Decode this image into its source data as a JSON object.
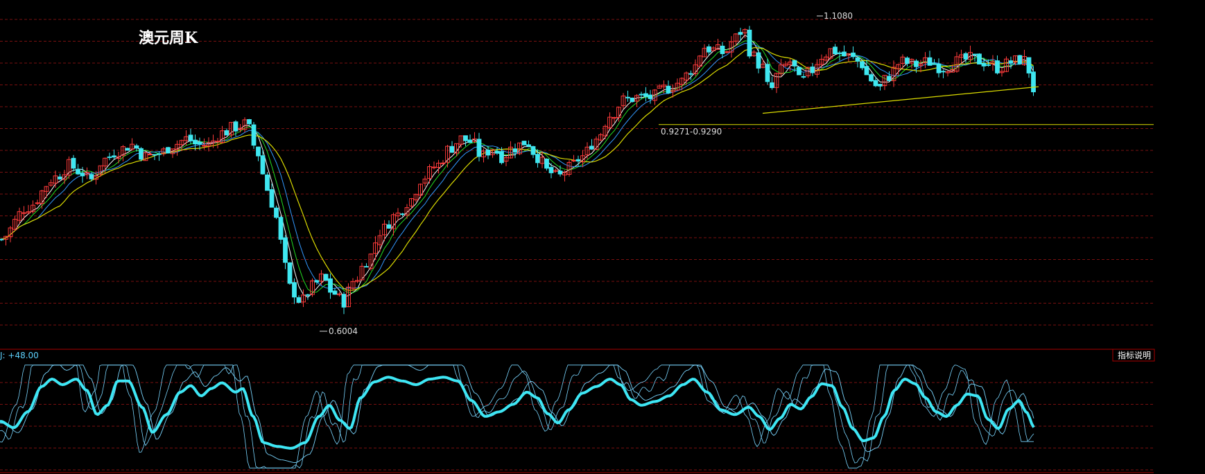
{
  "colors": {
    "background": "#000000",
    "grid": "#7a1010",
    "up_candle": "#ff3b3b",
    "down_candle": "#3fe7f0",
    "ma_short": "#ffffff",
    "ma_mid": "#ffff33",
    "ma_green": "#22dd22",
    "ma_blue": "#3399ff",
    "ma_long": "#dddd00",
    "trendline": "#dddd00",
    "kdj_bold": "#3ee6f4",
    "kdj_thin": "#7ad6ff",
    "separator": "#aa0000"
  },
  "header": {
    "title": "澳元周K"
  },
  "main_chart": {
    "annotations": {
      "high": "1.1080",
      "low": "0.6004",
      "level": "0.9271-0.9290"
    }
  },
  "indicator_panel": {
    "label": "J: +48.00",
    "legend_button": "指标说明"
  },
  "chart_data": [
    {
      "type": "candlestick",
      "title": "澳元周K",
      "ylim": [
        0.56,
        1.13
      ],
      "grid": true,
      "anchors": [
        [
          0,
          0.735
        ],
        [
          40,
          0.79
        ],
        [
          80,
          0.84
        ],
        [
          100,
          0.86
        ],
        [
          115,
          0.85
        ],
        [
          130,
          0.835
        ],
        [
          150,
          0.87
        ],
        [
          170,
          0.885
        ],
        [
          190,
          0.895
        ],
        [
          210,
          0.875
        ],
        [
          230,
          0.88
        ],
        [
          250,
          0.895
        ],
        [
          270,
          0.905
        ],
        [
          285,
          0.895
        ],
        [
          300,
          0.895
        ],
        [
          320,
          0.915
        ],
        [
          340,
          0.925
        ],
        [
          355,
          0.93
        ],
        [
          372,
          0.88
        ],
        [
          385,
          0.82
        ],
        [
          400,
          0.77
        ],
        [
          410,
          0.69
        ],
        [
          420,
          0.65
        ],
        [
          435,
          0.63
        ],
        [
          450,
          0.655
        ],
        [
          465,
          0.67
        ],
        [
          480,
          0.645
        ],
        [
          495,
          0.63
        ],
        [
          510,
          0.665
        ],
        [
          530,
          0.7
        ],
        [
          550,
          0.75
        ],
        [
          570,
          0.775
        ],
        [
          590,
          0.8
        ],
        [
          610,
          0.84
        ],
        [
          630,
          0.86
        ],
        [
          650,
          0.89
        ],
        [
          665,
          0.905
        ],
        [
          680,
          0.9
        ],
        [
          695,
          0.875
        ],
        [
          710,
          0.89
        ],
        [
          725,
          0.875
        ],
        [
          740,
          0.89
        ],
        [
          760,
          0.9
        ],
        [
          775,
          0.875
        ],
        [
          790,
          0.85
        ],
        [
          805,
          0.84
        ],
        [
          820,
          0.855
        ],
        [
          840,
          0.875
        ],
        [
          860,
          0.905
        ],
        [
          880,
          0.945
        ],
        [
          900,
          0.97
        ],
        [
          920,
          0.975
        ],
        [
          940,
          0.975
        ],
        [
          960,
          0.99
        ],
        [
          980,
          1.0
        ],
        [
          1000,
          1.025
        ],
        [
          1015,
          1.06
        ],
        [
          1030,
          1.055
        ],
        [
          1045,
          1.05
        ],
        [
          1060,
          1.075
        ],
        [
          1072,
          1.09
        ],
        [
          1085,
          1.045
        ],
        [
          1100,
          1.025
        ],
        [
          1110,
          0.985
        ],
        [
          1125,
          1.02
        ],
        [
          1140,
          1.035
        ],
        [
          1155,
          1.0
        ],
        [
          1170,
          1.02
        ],
        [
          1185,
          1.045
        ],
        [
          1200,
          1.055
        ],
        [
          1220,
          1.045
        ],
        [
          1240,
          1.035
        ],
        [
          1255,
          1.005
        ],
        [
          1268,
          0.99
        ],
        [
          1280,
          1.01
        ],
        [
          1300,
          1.035
        ],
        [
          1320,
          1.03
        ],
        [
          1340,
          1.035
        ],
        [
          1360,
          1.025
        ],
        [
          1380,
          1.035
        ],
        [
          1400,
          1.04
        ],
        [
          1420,
          1.035
        ],
        [
          1440,
          1.025
        ],
        [
          1460,
          1.035
        ],
        [
          1475,
          1.04
        ],
        [
          1485,
          1.02
        ],
        [
          1492,
          0.985
        ]
      ],
      "high_label": "1.1080",
      "low_label": "0.6004",
      "level_label": "0.9271-0.9290",
      "horizontal_level": 0.929,
      "trendline": {
        "from": [
          1100,
          0.948
        ],
        "to": [
          1498,
          0.993
        ]
      }
    },
    {
      "type": "line",
      "indicator": "KDJ",
      "ylim": [
        -10,
        110
      ],
      "label": "J: +48.00",
      "series_J_anchors": [
        [
          0,
          45
        ],
        [
          20,
          38
        ],
        [
          40,
          55
        ],
        [
          60,
          82
        ],
        [
          75,
          90
        ],
        [
          90,
          84
        ],
        [
          110,
          90
        ],
        [
          125,
          78
        ],
        [
          140,
          52
        ],
        [
          155,
          62
        ],
        [
          170,
          88
        ],
        [
          185,
          88
        ],
        [
          205,
          60
        ],
        [
          220,
          33
        ],
        [
          240,
          52
        ],
        [
          260,
          76
        ],
        [
          275,
          83
        ],
        [
          290,
          72
        ],
        [
          305,
          80
        ],
        [
          320,
          86
        ],
        [
          340,
          76
        ],
        [
          350,
          80
        ],
        [
          365,
          50
        ],
        [
          380,
          22
        ],
        [
          400,
          18
        ],
        [
          420,
          16
        ],
        [
          440,
          22
        ],
        [
          460,
          50
        ],
        [
          475,
          62
        ],
        [
          490,
          46
        ],
        [
          505,
          37
        ],
        [
          520,
          70
        ],
        [
          540,
          87
        ],
        [
          560,
          92
        ],
        [
          580,
          88
        ],
        [
          600,
          84
        ],
        [
          620,
          90
        ],
        [
          640,
          92
        ],
        [
          660,
          88
        ],
        [
          680,
          67
        ],
        [
          700,
          50
        ],
        [
          720,
          55
        ],
        [
          740,
          63
        ],
        [
          760,
          76
        ],
        [
          775,
          70
        ],
        [
          790,
          53
        ],
        [
          805,
          43
        ],
        [
          820,
          57
        ],
        [
          840,
          75
        ],
        [
          860,
          82
        ],
        [
          880,
          90
        ],
        [
          895,
          84
        ],
        [
          910,
          68
        ],
        [
          925,
          62
        ],
        [
          945,
          66
        ],
        [
          965,
          72
        ],
        [
          985,
          84
        ],
        [
          1000,
          90
        ],
        [
          1020,
          76
        ],
        [
          1040,
          57
        ],
        [
          1060,
          52
        ],
        [
          1080,
          60
        ],
        [
          1095,
          50
        ],
        [
          1110,
          36
        ],
        [
          1125,
          48
        ],
        [
          1140,
          63
        ],
        [
          1155,
          58
        ],
        [
          1170,
          71
        ],
        [
          1185,
          85
        ],
        [
          1200,
          83
        ],
        [
          1215,
          60
        ],
        [
          1230,
          37
        ],
        [
          1245,
          24
        ],
        [
          1260,
          27
        ],
        [
          1275,
          50
        ],
        [
          1290,
          78
        ],
        [
          1305,
          90
        ],
        [
          1320,
          85
        ],
        [
          1335,
          70
        ],
        [
          1350,
          55
        ],
        [
          1365,
          50
        ],
        [
          1380,
          62
        ],
        [
          1395,
          74
        ],
        [
          1410,
          72
        ],
        [
          1425,
          47
        ],
        [
          1440,
          37
        ],
        [
          1455,
          58
        ],
        [
          1470,
          67
        ],
        [
          1480,
          55
        ],
        [
          1492,
          38
        ]
      ]
    }
  ]
}
